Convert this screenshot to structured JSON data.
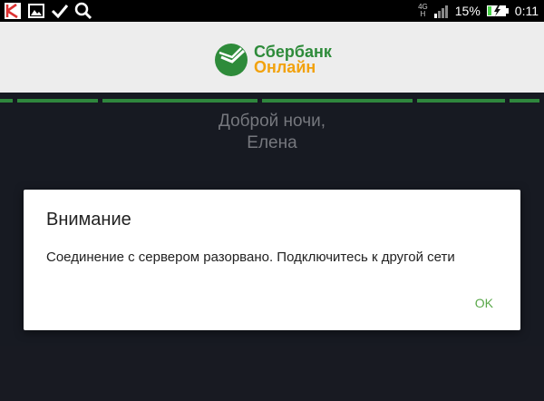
{
  "status_bar": {
    "icons_left": [
      "kaspersky-icon",
      "gallery-icon",
      "check-icon",
      "search-icon"
    ],
    "network_label_top": "4G",
    "network_label_bottom": "H",
    "battery_percent": "15%",
    "time": "0:11"
  },
  "header": {
    "logo_line1": "Сбербанк",
    "logo_line2": "Онлайн",
    "brand_color": "#2e8b3a",
    "accent_color": "#f2a20d"
  },
  "greeting": {
    "line1": "Доброй ночи,",
    "line2": "Елена"
  },
  "dialog": {
    "title": "Внимание",
    "message": "Соединение с сервером разорвано. Подключитесь к другой сети",
    "ok_label": "OK",
    "ok_color": "#5aa84a"
  }
}
